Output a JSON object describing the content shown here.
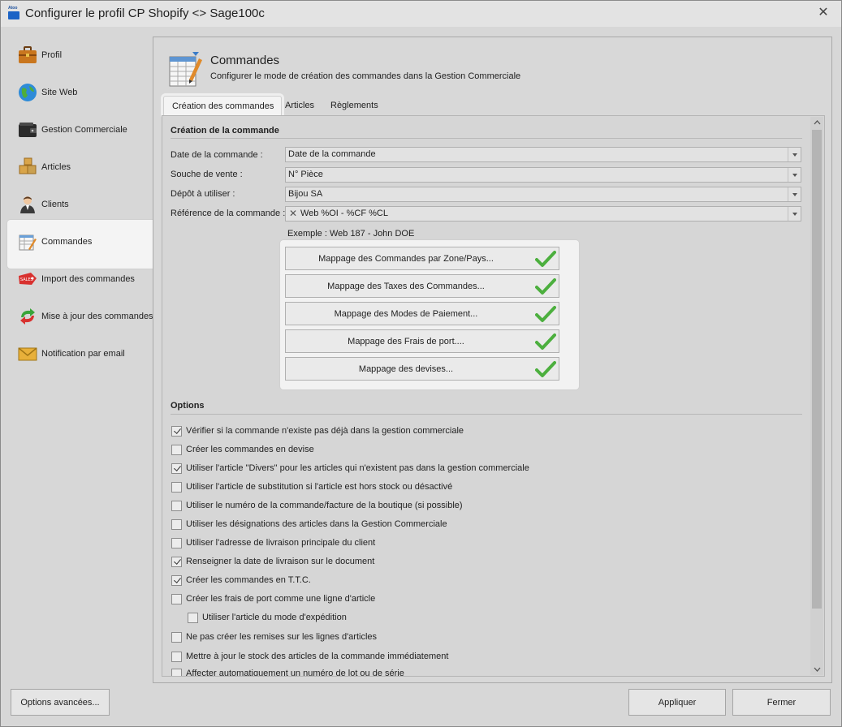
{
  "window": {
    "logo_text": "Atoo sync",
    "title": "Configurer le profil CP Shopify <> Sage100c",
    "close_glyph": "✕"
  },
  "sidebar": {
    "items": [
      {
        "label": "Profil",
        "icon": "briefcase-icon"
      },
      {
        "label": "Site Web",
        "icon": "globe-icon"
      },
      {
        "label": "Gestion Commerciale",
        "icon": "wallet-icon"
      },
      {
        "label": "Articles",
        "icon": "boxes-icon"
      },
      {
        "label": "Clients",
        "icon": "user-icon"
      },
      {
        "label": "Commandes",
        "icon": "order-sheet-icon"
      },
      {
        "label": "Import des commandes",
        "icon": "sales-tag-icon"
      },
      {
        "label": "Mise à jour des commandes",
        "icon": "sync-arrows-icon"
      },
      {
        "label": "Notification par email",
        "icon": "envelope-icon"
      }
    ],
    "selected": "Commandes",
    "sales_tag_text": "SALES"
  },
  "header": {
    "title": "Commandes",
    "description": "Configurer le mode de création des commandes dans la Gestion Commerciale"
  },
  "tabs": [
    {
      "label": "Création des commandes",
      "active": true
    },
    {
      "label": "Articles",
      "active": false
    },
    {
      "label": "Règlements",
      "active": false
    }
  ],
  "creation": {
    "section_title": "Création de la commande",
    "fields": [
      {
        "label": "Date de la commande :",
        "value": "Date de la commande"
      },
      {
        "label": "Souche de vente :",
        "value": "N° Pièce"
      },
      {
        "label": "Dépôt à utiliser :",
        "value": "Bijou SA"
      },
      {
        "label": "Référence de la commande :",
        "value": "Web %OI - %CF %CL"
      }
    ],
    "clear_glyph": "✕",
    "example": "Exemple : Web 187 - John DOE"
  },
  "mapping_buttons": [
    {
      "label": "Mappage des Commandes par Zone/Pays...",
      "configured": true
    },
    {
      "label": "Mappage des Taxes des Commandes...",
      "configured": true
    },
    {
      "label": "Mappage des Modes de Paiement...",
      "configured": true
    },
    {
      "label": "Mappage des Frais de port....",
      "configured": true
    },
    {
      "label": "Mappage des devises...",
      "configured": true
    }
  ],
  "options": {
    "section_title": "Options",
    "items": [
      {
        "label": "Vérifier si la commande n'existe pas déjà dans la gestion commerciale",
        "checked": true,
        "indent": false
      },
      {
        "label": "Créer les commandes en devise",
        "checked": false,
        "indent": false
      },
      {
        "label": "Utiliser l'article \"Divers\" pour les articles qui n'existent pas dans la gestion commerciale",
        "checked": true,
        "indent": false
      },
      {
        "label": "Utiliser l'article de substitution si l'article est hors stock ou désactivé",
        "checked": false,
        "indent": false
      },
      {
        "label": "Utiliser le numéro de la commande/facture de la boutique (si possible)",
        "checked": false,
        "indent": false
      },
      {
        "label": "Utiliser les désignations des articles dans la Gestion Commerciale",
        "checked": false,
        "indent": false
      },
      {
        "label": "Utiliser l'adresse de livraison principale du client",
        "checked": false,
        "indent": false
      },
      {
        "label": "Renseigner la date de livraison sur le document",
        "checked": true,
        "indent": false
      },
      {
        "label": "Créer les commandes en T.T.C.",
        "checked": true,
        "indent": false
      },
      {
        "label": "Créer les frais de port comme une ligne d'article",
        "checked": false,
        "indent": false
      },
      {
        "label": "Utiliser l'article du mode d'expédition",
        "checked": false,
        "indent": true
      },
      {
        "label": "Ne pas créer les remises sur les lignes d'articles",
        "checked": false,
        "indent": false
      },
      {
        "label": "Mettre à jour le stock des articles de la commande immédiatement",
        "checked": false,
        "indent": false
      },
      {
        "label": "Affecter automatiquement un numéro de lot ou de série",
        "checked": false,
        "indent": false
      }
    ]
  },
  "footer": {
    "advanced_label": "Options avancées...",
    "apply_label": "Appliquer",
    "close_label": "Fermer"
  },
  "colors": {
    "check_green": "#4caf3e",
    "app_blue": "#1b63c6"
  }
}
